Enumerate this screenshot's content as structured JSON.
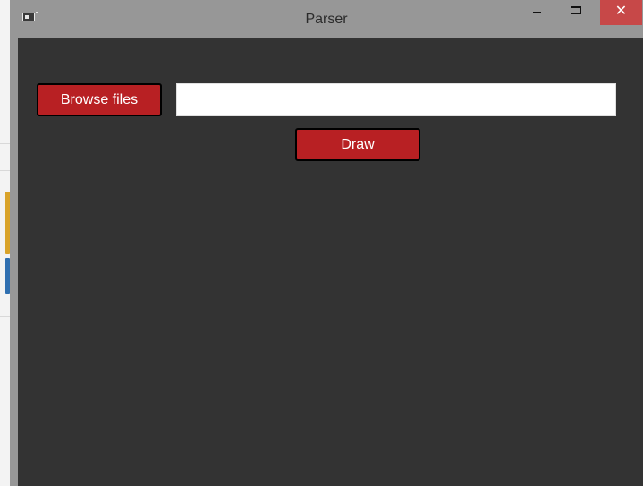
{
  "window": {
    "title": "Parser",
    "icon": "app-window-icon",
    "controls": {
      "minimize_icon": "minimize-icon",
      "maximize_icon": "maximize-icon",
      "close_glyph": "✕"
    }
  },
  "form": {
    "browse_label": "Browse files",
    "path_value": "",
    "path_placeholder": "",
    "draw_label": "Draw"
  },
  "colors": {
    "titlebar": "#979797",
    "client_background": "#333333",
    "button_red": "#b82023",
    "close_button": "#c74848"
  }
}
